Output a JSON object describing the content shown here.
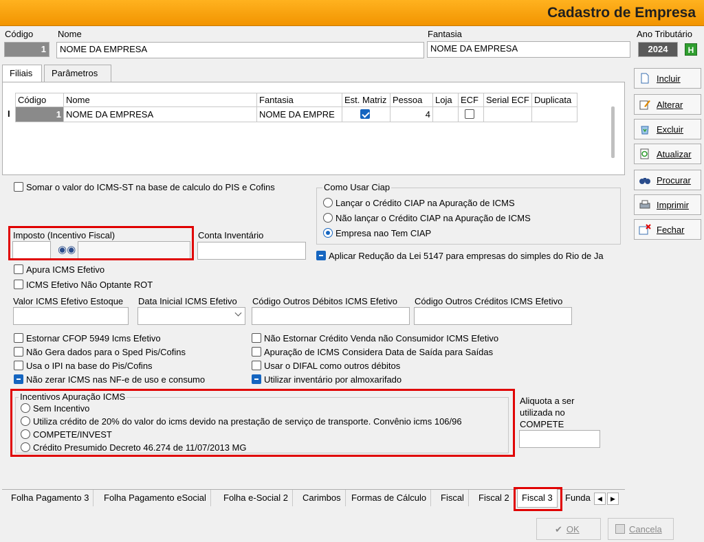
{
  "window": {
    "title": "Cadastro de Empresa"
  },
  "header": {
    "codigo_label": "Código",
    "codigo_value": "1",
    "nome_label": "Nome",
    "nome_value": "NOME DA EMPRESA",
    "fantasia_label": "Fantasia",
    "fantasia_value": "NOME DA EMPRESA",
    "ano_label": "Ano Tributário",
    "ano_value": "2024",
    "ano_button": "H"
  },
  "tabs_top": [
    {
      "label": "Filiais"
    },
    {
      "label": "Parâmetros"
    }
  ],
  "grid": {
    "columns": [
      "Código",
      "Nome",
      "Fantasia",
      "Est. Matriz",
      "Pessoa",
      "Loja",
      "ECF",
      "Serial ECF",
      "Duplicata"
    ],
    "row": {
      "cursor": "I",
      "codigo": "1",
      "nome": "NOME DA EMPRESA",
      "fantasia": "NOME DA EMPRE",
      "matriz": true,
      "pessoa": "4",
      "loja": "",
      "ecf": false,
      "serial": "",
      "duplicata": ""
    }
  },
  "options": {
    "somar_icms_st": "Somar o valor do ICMS-ST na base de calculo do PIS e Cofins",
    "imposto_label": "Imposto (Incentivo Fiscal)",
    "conta_inventario_label": "Conta Inventário",
    "apura_icms_efetivo": "Apura ICMS Efetivo",
    "icms_nao_optante": "ICMS Efetivo Não Optante ROT",
    "valor_icms_estoque_label": "Valor ICMS Efetivo Estoque",
    "data_inicial_label": "Data Inicial ICMS Efetivo",
    "codigo_outros_debitos_label": "Código Outros Débitos ICMS Efetivo",
    "codigo_outros_creditos_label": "Código Outros Créditos ICMS Efetivo",
    "estornar_cfop": "Estornar CFOP 5949 Icms Efetivo",
    "nao_gera_sped": "Não Gera dados para o Sped Pis/Cofins",
    "usa_ipi": "Usa o IPI na base do Pis/Cofins",
    "nao_zerar_icms": "Não zerar ICMS  nas NF-e de uso e consumo",
    "nao_estornar_credito": "Não Estornar Crédito Venda não Consumidor ICMS Efetivo",
    "apuracao_data_saida": "Apuração de ICMS Considera Data de Saída para Saídas",
    "usar_difal": "Usar o DIFAL como outros débitos",
    "utilizar_inventario": "Utilizar inventário por almoxarifado",
    "aplicar_reducao": "Aplicar Redução da Lei 5147 para empresas do simples do Rio de Ja"
  },
  "ciap": {
    "title": "Como Usar Ciap",
    "opt1": "Lançar o Crédito CIAP na Apuração de ICMS",
    "opt2": "Não lançar o Crédito CIAP na Apuração de ICMS",
    "opt3": "Empresa nao Tem CIAP"
  },
  "incentivos": {
    "title": "Incentivos Apuração ICMS",
    "opt1": "Sem Incentivo",
    "opt2": "Utiliza crédito de 20% do valor do icms devido na prestação de serviço de transporte. Convênio icms 106/96",
    "opt3": "COMPETE/INVEST",
    "opt4": "Crédito Presumido Decreto 46.274 de 11/07/2013 MG"
  },
  "aliquota": {
    "line1": "Aliquota a ser",
    "line2": "utilizada no",
    "line3": "COMPETE"
  },
  "side_buttons": [
    {
      "label": "Incluir",
      "icon": "document-icon"
    },
    {
      "label": "Alterar",
      "icon": "edit-icon"
    },
    {
      "label": "Excluir",
      "icon": "recycle-icon"
    },
    {
      "label": "Atualizar",
      "icon": "refresh-icon"
    },
    {
      "label": "Procurar",
      "icon": "binoculars-icon"
    },
    {
      "label": "Imprimir",
      "icon": "printer-icon"
    },
    {
      "label": "Fechar",
      "icon": "close-window-icon"
    }
  ],
  "bottom_tabs": [
    {
      "label": "Folha Pagamento 3"
    },
    {
      "label": "Folha Pagamento eSocial"
    },
    {
      "label": "Folha e-Social 2"
    },
    {
      "label": "Carimbos"
    },
    {
      "label": "Formas de Cálculo"
    },
    {
      "label": "Fiscal"
    },
    {
      "label": "Fiscal 2"
    },
    {
      "label": "Fiscal 3"
    },
    {
      "label": "Funda"
    }
  ],
  "footer": {
    "ok": "OK",
    "cancel": "Cancela"
  },
  "colors": {
    "title_bar": "#f29400",
    "accent": "#1565c0",
    "highlight": "#e00000"
  }
}
